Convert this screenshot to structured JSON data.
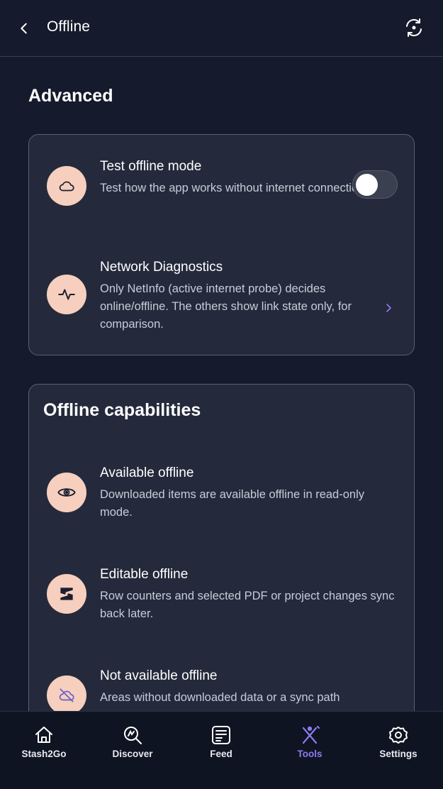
{
  "header": {
    "title": "Offline",
    "back_icon": "chevron-left-icon",
    "sync_icon": "sync-icon"
  },
  "advanced": {
    "section_title": "Advanced",
    "rows": [
      {
        "title": "Test offline mode",
        "description": "Test how the app works without internet connection",
        "icon": "cloud-icon",
        "toggle_on": false
      },
      {
        "title": "Network Diagnostics",
        "description": "Only NetInfo (active internet probe) decides online/offline. The others show link state only, for comparison.",
        "icon": "activity-icon"
      }
    ]
  },
  "capabilities": {
    "title": "Offline capabilities",
    "rows": [
      {
        "title": "Available offline",
        "description": "Downloaded items are available offline in read-only mode.",
        "icon": "eye-icon"
      },
      {
        "title": "Editable offline",
        "description": "Row counters and selected PDF or project changes sync back later.",
        "icon": "edit-sync-icon"
      },
      {
        "title": "Not available offline",
        "description": "Areas without downloaded data or a sync path",
        "icon": "cloud-off-icon"
      }
    ]
  },
  "nav": {
    "items": [
      {
        "label": "Stash2Go",
        "icon": "home-icon",
        "active": false
      },
      {
        "label": "Discover",
        "icon": "discover-icon",
        "active": false
      },
      {
        "label": "Feed",
        "icon": "feed-icon",
        "active": false
      },
      {
        "label": "Tools",
        "icon": "tools-icon",
        "active": true
      },
      {
        "label": "Settings",
        "icon": "settings-icon",
        "active": false
      }
    ]
  },
  "colors": {
    "background": "#151b2c",
    "card": "#242a3b",
    "icon_circle": "#f6cfbe",
    "accent": "#8b7cf0"
  }
}
